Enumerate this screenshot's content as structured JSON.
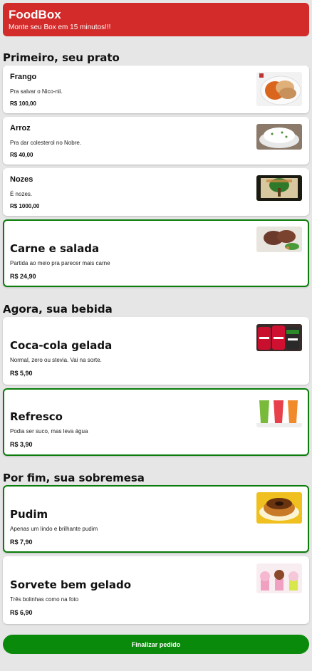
{
  "header": {
    "title": "FoodBox",
    "subtitle": "Monte seu Box em 15 minutos!!!"
  },
  "sections": [
    {
      "title": "Primeiro, seu prato"
    },
    {
      "title": "Agora, sua bebida"
    },
    {
      "title": "Por fim, sua sobremesa"
    }
  ],
  "dishes": [
    {
      "name": "Frango",
      "desc": "Pra salvar o Nico-nii.",
      "price": "R$ 100,00",
      "icon": "chicken-photo"
    },
    {
      "name": "Arroz",
      "desc": "Pra dar colesterol no Nobre.",
      "price": "R$ 40,00",
      "icon": "rice-photo"
    },
    {
      "name": "Nozes",
      "desc": "É nozes.",
      "price": "R$ 1000,00",
      "icon": "nuts-photo"
    },
    {
      "name": "Carne e salada",
      "desc": "Partida ao meio pra parecer mais carne",
      "price": "R$ 24,90",
      "icon": "meat-salad-photo",
      "selected": true
    }
  ],
  "drinks": [
    {
      "name": "Coca-cola gelada",
      "desc": "Normal, zero ou stevia. Vai na sorte.",
      "price": "R$ 5,90",
      "icon": "coca-cola-photo"
    },
    {
      "name": "Refresco",
      "desc": "Podia ser suco, mas leva água",
      "price": "R$ 3,90",
      "icon": "juice-photo",
      "selected": true
    }
  ],
  "desserts": [
    {
      "name": "Pudim",
      "desc": "Apenas um lindo e brilhante pudim",
      "price": "R$ 7,90",
      "icon": "pudding-photo",
      "selected": true
    },
    {
      "name": "Sorvete bem gelado",
      "desc": "Três bolinhas como na foto",
      "price": "R$ 6,90",
      "icon": "ice-cream-photo"
    }
  ],
  "footer": {
    "finalize_label": "Finalizar pedido"
  },
  "colors": {
    "header": "#d32a2a",
    "selected_border": "#0a7d0a",
    "finalize_button": "#0a8a0a",
    "background": "#e6e6e6"
  }
}
